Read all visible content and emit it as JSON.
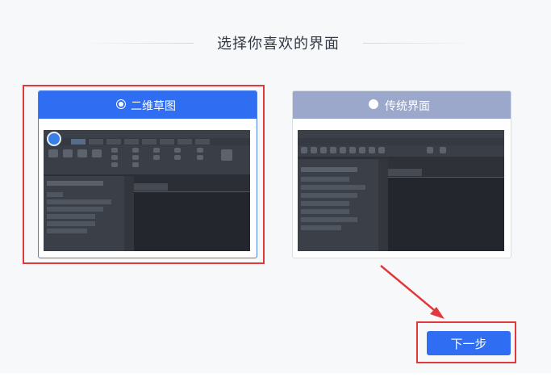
{
  "title": "选择你喜欢的界面",
  "options": [
    {
      "label": "二维草图",
      "selected": true
    },
    {
      "label": "传统界面",
      "selected": false
    }
  ],
  "next_button": "下一步",
  "colors": {
    "accent": "#2f6df2",
    "highlight": "#e2383b",
    "inactive_header": "#9ba8cc"
  }
}
